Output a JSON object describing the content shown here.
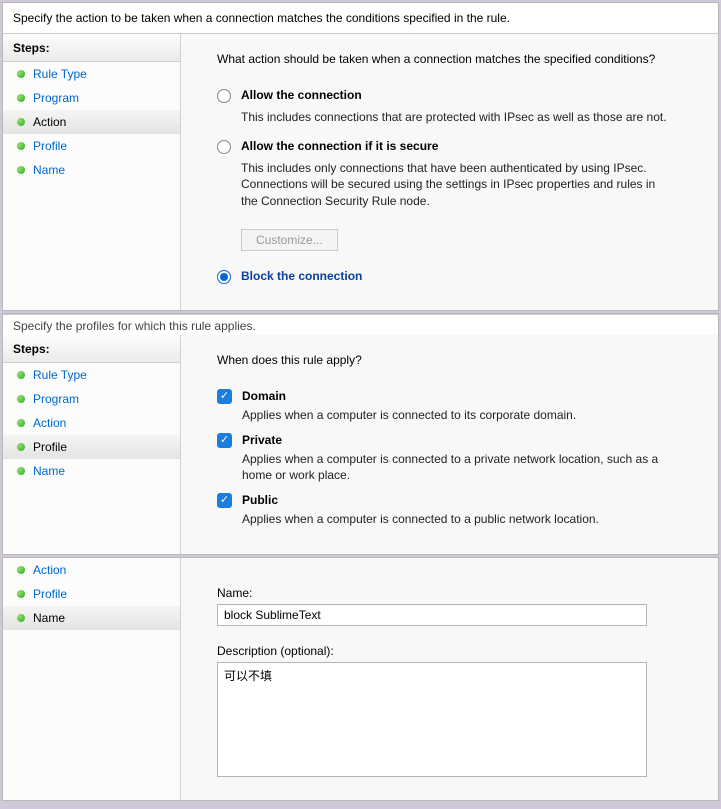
{
  "panel1": {
    "description": "Specify the action to be taken when a connection matches the conditions specified in the rule.",
    "sidebar_title": "Steps:",
    "steps": [
      {
        "label": "Rule Type"
      },
      {
        "label": "Program"
      },
      {
        "label": "Action"
      },
      {
        "label": "Profile"
      },
      {
        "label": "Name"
      }
    ],
    "question": "What action should be taken when a connection matches the specified conditions?",
    "options": [
      {
        "label": "Allow the connection",
        "description": "This includes connections that are protected with IPsec as well as those are not."
      },
      {
        "label": "Allow the connection if it is secure",
        "description": "This includes only connections that have been authenticated by using IPsec.  Connections will be secured using the settings in IPsec properties and rules in the Connection Security Rule node."
      },
      {
        "label": "Block the connection"
      }
    ],
    "customize_label": "Customize..."
  },
  "panel2": {
    "truncated_header": "Specify the profiles for which this rule applies.",
    "sidebar_title": "Steps:",
    "steps": [
      {
        "label": "Rule Type"
      },
      {
        "label": "Program"
      },
      {
        "label": "Action"
      },
      {
        "label": "Profile"
      },
      {
        "label": "Name"
      }
    ],
    "question": "When does this rule apply?",
    "checks": [
      {
        "label": "Domain",
        "description": "Applies when a computer is connected to its corporate domain."
      },
      {
        "label": "Private",
        "description": "Applies when a computer is connected to a private network location, such as a home or work place."
      },
      {
        "label": "Public",
        "description": "Applies when a computer is connected to a public network location."
      }
    ]
  },
  "panel3": {
    "steps": [
      {
        "label": "Action"
      },
      {
        "label": "Profile"
      },
      {
        "label": "Name"
      }
    ],
    "name_label": "Name:",
    "name_value": "block SublimeText",
    "desc_label": "Description (optional):",
    "desc_value": "可以不填"
  }
}
